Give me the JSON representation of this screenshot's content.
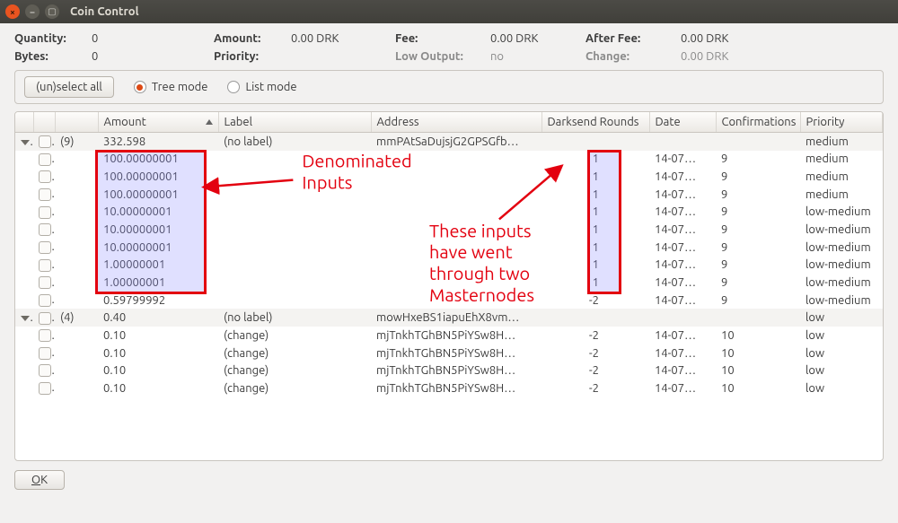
{
  "window": {
    "title": "Coin Control"
  },
  "stats": {
    "quantity_label": "Quantity:",
    "quantity_value": "0",
    "amount_label": "Amount:",
    "amount_value": "0.00 DRK",
    "fee_label": "Fee:",
    "fee_value": "0.00 DRK",
    "afterfee_label": "After Fee:",
    "afterfee_value": "0.00 DRK",
    "bytes_label": "Bytes:",
    "bytes_value": "0",
    "priority_label": "Priority:",
    "priority_value": "",
    "lowout_label": "Low Output:",
    "lowout_value": "no",
    "change_label": "Change:",
    "change_value": "0.00 DRK"
  },
  "modebar": {
    "select_all": "(un)select all",
    "tree_mode": "Tree mode",
    "list_mode": "List mode",
    "selected": "tree"
  },
  "columns": {
    "amount": "Amount",
    "label": "Label",
    "address": "Address",
    "rounds": "Darksend Rounds",
    "date": "Date",
    "confirmations": "Confirmations",
    "priority": "Priority"
  },
  "rows": [
    {
      "kind": "group",
      "count": "(9)",
      "amount": "332.598",
      "label": "(no label)",
      "address": "mmPAtSaDujsjG2GPSGfb…",
      "rounds": "",
      "date": "",
      "conf": "",
      "prio": "medium"
    },
    {
      "kind": "child",
      "amount": "100.00000001",
      "label": "",
      "address": "",
      "rounds": "1",
      "date": "14-07…",
      "conf": "9",
      "prio": "medium",
      "hl_amount": true,
      "hl_rounds": true
    },
    {
      "kind": "child",
      "amount": "100.00000001",
      "label": "",
      "address": "",
      "rounds": "1",
      "date": "14-07…",
      "conf": "9",
      "prio": "medium",
      "hl_amount": true,
      "hl_rounds": true
    },
    {
      "kind": "child",
      "amount": "100.00000001",
      "label": "",
      "address": "",
      "rounds": "1",
      "date": "14-07…",
      "conf": "9",
      "prio": "medium",
      "hl_amount": true,
      "hl_rounds": true
    },
    {
      "kind": "child",
      "amount": "10.00000001",
      "label": "",
      "address": "",
      "rounds": "1",
      "date": "14-07…",
      "conf": "9",
      "prio": "low-medium",
      "hl_amount": true,
      "hl_rounds": true
    },
    {
      "kind": "child",
      "amount": "10.00000001",
      "label": "",
      "address": "",
      "rounds": "1",
      "date": "14-07…",
      "conf": "9",
      "prio": "low-medium",
      "hl_amount": true,
      "hl_rounds": true
    },
    {
      "kind": "child",
      "amount": "10.00000001",
      "label": "",
      "address": "",
      "rounds": "1",
      "date": "14-07…",
      "conf": "9",
      "prio": "low-medium",
      "hl_amount": true,
      "hl_rounds": true
    },
    {
      "kind": "child",
      "amount": "1.00000001",
      "label": "",
      "address": "",
      "rounds": "1",
      "date": "14-07…",
      "conf": "9",
      "prio": "low-medium",
      "hl_amount": true,
      "hl_rounds": true
    },
    {
      "kind": "child",
      "amount": "1.00000001",
      "label": "",
      "address": "",
      "rounds": "1",
      "date": "14-07…",
      "conf": "9",
      "prio": "low-medium",
      "hl_amount": true,
      "hl_rounds": true
    },
    {
      "kind": "child",
      "amount": "0.59799992",
      "label": "",
      "address": "",
      "rounds": "-2",
      "date": "14-07…",
      "conf": "9",
      "prio": "low-medium"
    },
    {
      "kind": "group",
      "count": "(4)",
      "amount": "0.40",
      "label": "(no label)",
      "address": "mowHxeBS1iapuEhX8vm…",
      "rounds": "",
      "date": "",
      "conf": "",
      "prio": "low"
    },
    {
      "kind": "child",
      "amount": "0.10",
      "label": "(change)",
      "address": "mjTnkhTGhBN5PiYSw8H…",
      "rounds": "-2",
      "date": "14-07…",
      "conf": "10",
      "prio": "low"
    },
    {
      "kind": "child",
      "amount": "0.10",
      "label": "(change)",
      "address": "mjTnkhTGhBN5PiYSw8H…",
      "rounds": "-2",
      "date": "14-07…",
      "conf": "10",
      "prio": "low"
    },
    {
      "kind": "child",
      "amount": "0.10",
      "label": "(change)",
      "address": "mjTnkhTGhBN5PiYSw8H…",
      "rounds": "-2",
      "date": "14-07…",
      "conf": "10",
      "prio": "low"
    },
    {
      "kind": "child",
      "amount": "0.10",
      "label": "(change)",
      "address": "mjTnkhTGhBN5PiYSw8H…",
      "rounds": "-2",
      "date": "14-07…",
      "conf": "10",
      "prio": "low"
    }
  ],
  "annotations": {
    "denom_label_1": "Denominated",
    "denom_label_2": "Inputs",
    "rounds_label_1": "These inputs",
    "rounds_label_2": "have went",
    "rounds_label_3": "through two",
    "rounds_label_4": "Masternodes"
  },
  "footer": {
    "ok_prefix": "O",
    "ok_rest": "K"
  }
}
